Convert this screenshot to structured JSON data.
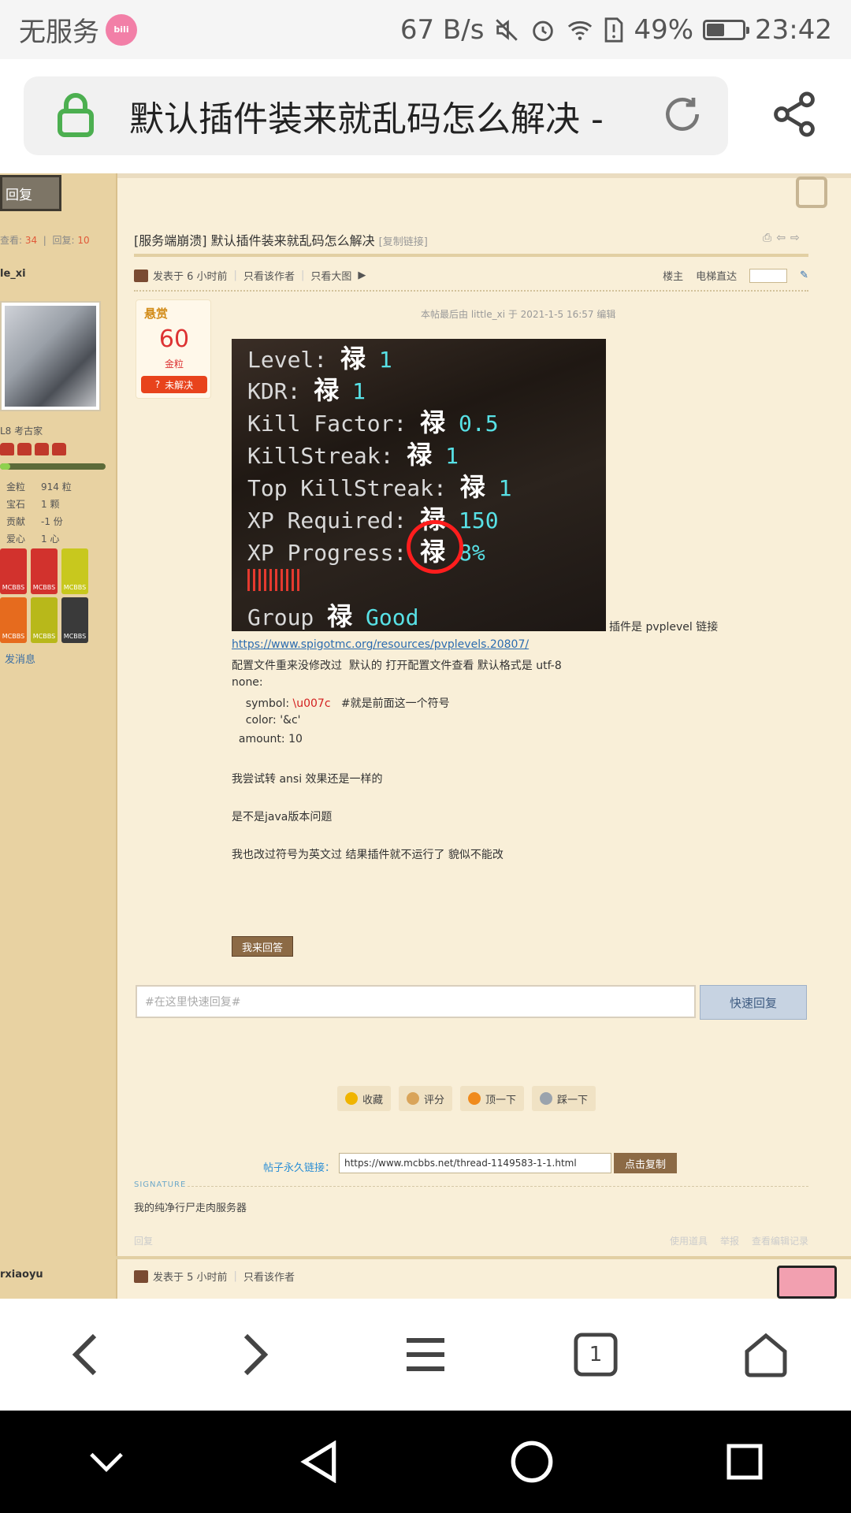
{
  "status_bar": {
    "carrier": "无服务",
    "net_speed": "67 B/s",
    "battery": "49%",
    "battery_level": 0.49,
    "time": "23:42",
    "icons": [
      "bilibili-icon",
      "mute-icon",
      "alarm-icon",
      "wifi-icon",
      "sim-alert-icon",
      "battery-icon"
    ]
  },
  "browser": {
    "page_title": "默认插件装来就乱码怎么解决 -",
    "toolbar_icons": [
      "back-icon",
      "forward-icon",
      "menu-icon",
      "tabs-icon",
      "home-icon"
    ],
    "tab_count": "1"
  },
  "page": {
    "reply_button": "回复",
    "stats": {
      "views_label": "查看:",
      "views": "34",
      "replies_label": "回复:",
      "replies": "10"
    },
    "author": {
      "name": "le_xi",
      "rank": "L8 考古家",
      "stats": [
        {
          "key": "金粒",
          "value": "914 粒"
        },
        {
          "key": "宝石",
          "value": "1 颗"
        },
        {
          "key": "贡献",
          "value": "-1 份"
        },
        {
          "key": "爱心",
          "value": "1 心"
        }
      ],
      "badges": [
        "MCBBS",
        "MCBBS",
        "MCBBS",
        "MCBBS",
        "MCBBS",
        "MCBBS"
      ],
      "send_message": "发消息"
    },
    "thread": {
      "title": "[服务端崩溃] 默认插件装来就乱码怎么解决",
      "copy_link": "[复制链接]",
      "posted": "发表于 6 小时前",
      "only_author": "只看该作者",
      "big_image": "只看大图",
      "floor_label": "楼主",
      "elevator_label": "电梯直达"
    },
    "reward": {
      "label": "悬赏",
      "amount": "60",
      "unit": "金粒",
      "status": "未解决"
    },
    "edit_note": "本帖最后由 little_xi 于 2021-1-5 16:57 编辑",
    "screenshot": {
      "lines": [
        {
          "label": "Level:",
          "glyph": "禄",
          "value": "1"
        },
        {
          "label": "KDR:",
          "glyph": "禄",
          "value": "1"
        },
        {
          "label": "Kill Factor:",
          "glyph": "禄",
          "value": "0.5"
        },
        {
          "label": "KillStreak:",
          "glyph": "禄",
          "value": "1"
        },
        {
          "label": "Top KillStreak:",
          "glyph": "禄",
          "value": "1"
        },
        {
          "label": "XP Required:",
          "glyph": "禄",
          "value": "150"
        },
        {
          "label": "XP Progress:",
          "glyph": "禄",
          "value": "8%"
        },
        {
          "label": "Group",
          "glyph": "禄",
          "value": "Good"
        }
      ]
    },
    "body": {
      "plugin_note": "插件是 pvplevel  链接",
      "link": "https://www.spigotmc.org/resources/pvplevels.20807/",
      "line1": "配置文件重来没修改过  默认的 打开配置文件查看 默认格式是 utf-8",
      "line2": "none:",
      "line3_prefix": "    symbol: ",
      "line3_code": "\\u007c",
      "line3_comment": "   #就是前面这一个符号",
      "line4": "    color: '&c'",
      "line5": "  amount: 10",
      "line6": "我尝试转 ansi 效果还是一样的",
      "line7": "是不是java版本问题",
      "line8": "我也改过符号为英文过 结果插件就不运行了 貌似不能改"
    },
    "answer_button": "我来回答",
    "quick_reply": {
      "placeholder": "#在这里快速回复#",
      "button": "快速回复"
    },
    "actions": [
      "收藏",
      "评分",
      "顶一下",
      "踩一下"
    ],
    "permalink": {
      "label": "帖子永久链接：",
      "url": "https://www.mcbbs.net/thread-1149583-1-1.html",
      "copy_button": "点击复制"
    },
    "signature": {
      "label": "SIGNATURE",
      "text": "我的纯净行尸走肉服务器"
    },
    "post_footer": {
      "reply": "回复",
      "tools": "使用道具",
      "report": "举报",
      "history": "查看编辑记录"
    },
    "next_post": {
      "author": "rxiaoyu",
      "posted": "发表于 5 小时前",
      "only_author": "只看该作者"
    }
  },
  "colors": {
    "page_bg": "#f9efd8",
    "sidebar_bg": "#e8d2a2",
    "accent_brown": "#8c6a45",
    "link_blue": "#2b6cb0",
    "lock_green": "#4caf50"
  }
}
